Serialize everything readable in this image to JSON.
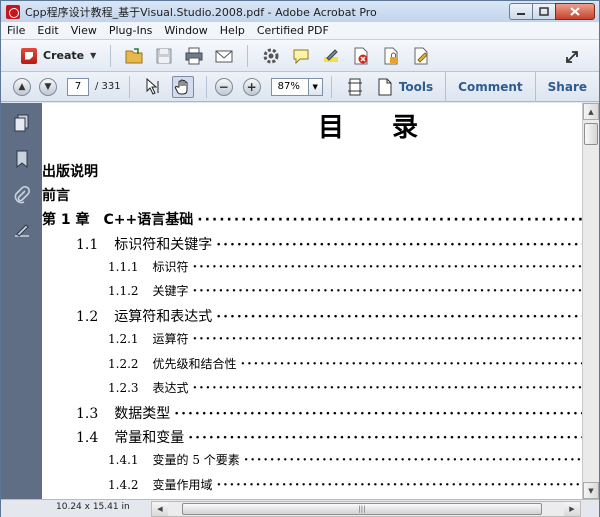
{
  "window": {
    "title": "Cpp程序设计教程_基于Visual.Studio.2008.pdf - Adobe Acrobat Pro"
  },
  "menu": [
    "File",
    "Edit",
    "View",
    "Plug-Ins",
    "Window",
    "Help",
    "Certified PDF"
  ],
  "toolbar": {
    "create_label": "Create"
  },
  "navigation": {
    "current_page": "7",
    "total_pages": "/ 331",
    "zoom": "87%"
  },
  "panels": [
    "Tools",
    "Comment",
    "Share"
  ],
  "document": {
    "title": "目录",
    "toc": [
      {
        "num": "",
        "label": "出版说明",
        "level": 0,
        "dots": false
      },
      {
        "num": "",
        "label": "前言",
        "level": 0,
        "dots": false
      },
      {
        "num": "第 1 章",
        "label": "C++语言基础",
        "level": 0,
        "dots": true
      },
      {
        "num": "1.1",
        "label": "标识符和关键字",
        "level": 1,
        "dots": true
      },
      {
        "num": "1.1.1",
        "label": "标识符",
        "level": 2,
        "dots": true
      },
      {
        "num": "1.1.2",
        "label": "关键字",
        "level": 2,
        "dots": true
      },
      {
        "num": "1.2",
        "label": "运算符和表达式",
        "level": 1,
        "dots": true
      },
      {
        "num": "1.2.1",
        "label": "运算符",
        "level": 2,
        "dots": true
      },
      {
        "num": "1.2.2",
        "label": "优先级和结合性",
        "level": 2,
        "dots": true
      },
      {
        "num": "1.2.3",
        "label": "表达式",
        "level": 2,
        "dots": true
      },
      {
        "num": "1.3",
        "label": "数据类型",
        "level": 1,
        "dots": true
      },
      {
        "num": "1.4",
        "label": "常量和变量",
        "level": 1,
        "dots": true
      },
      {
        "num": "1.4.1",
        "label": "变量的 5 个要素",
        "level": 2,
        "dots": true
      },
      {
        "num": "1.4.2",
        "label": "变量作用域",
        "level": 2,
        "dots": true
      }
    ]
  },
  "status": {
    "page_size": "10.24 x 15.41 in"
  }
}
